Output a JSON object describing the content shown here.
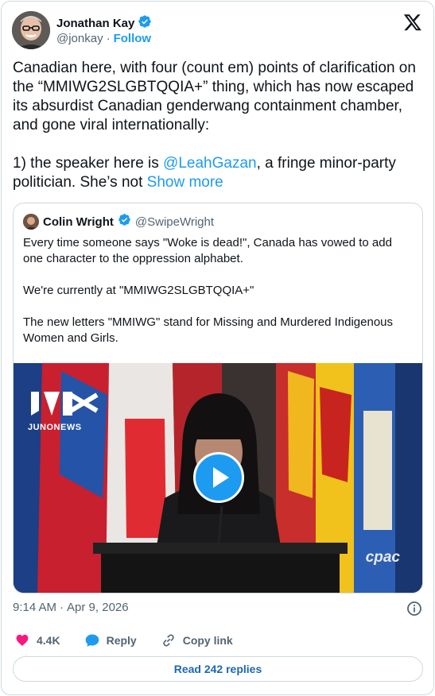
{
  "author": {
    "name": "Jonathan Kay",
    "handle": "@jonkay",
    "separator": "·",
    "follow_label": "Follow"
  },
  "tweet": {
    "text_before_mention": "Canadian here, with four (count em) points of clarification on the “MMIWG2SLGBTQQIA+” thing, which has now escaped its absurdist Canadian genderwang containment chamber, and gone viral internationally:\n\n1) the speaker here is ",
    "mention": "@LeahGazan",
    "text_after_mention": ", a fringe minor-party politician. She’s not ",
    "show_more": "Show more"
  },
  "quote": {
    "name": "Colin Wright",
    "handle": "@SwipeWright",
    "paragraphs": [
      "Every time someone says \"Woke is dead!\", Canada has vowed to add one character to the oppression alphabet.",
      "We're currently at \"MMIWG2SLGBTQQIA+\"",
      "The new letters \"MMIWG\" stand for Missing and Murdered Indigenous Women and Girls."
    ],
    "video": {
      "watermark_left": "JUNONEWS",
      "watermark_right": "cpac"
    }
  },
  "meta": {
    "time": "9:14 AM",
    "separator": "·",
    "date": "Apr 9, 2026"
  },
  "actions": {
    "like_count": "4.4K",
    "reply_label": "Reply",
    "copy_link_label": "Copy link"
  },
  "read_replies_label": "Read 242 replies",
  "colors": {
    "accent": "#1d9bf0",
    "like": "#f91880",
    "verified": "#1d9bf0"
  }
}
